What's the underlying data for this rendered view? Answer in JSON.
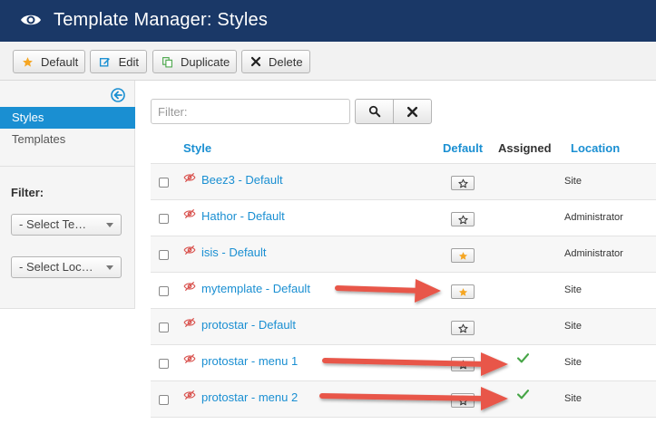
{
  "header": {
    "title": "Template Manager: Styles",
    "icon": "eye-icon"
  },
  "toolbar": {
    "buttons": [
      {
        "label": "Default",
        "icon": "star-icon"
      },
      {
        "label": "Edit",
        "icon": "edit-icon"
      },
      {
        "label": "Duplicate",
        "icon": "duplicate-icon"
      },
      {
        "label": "Delete",
        "icon": "close-icon"
      }
    ]
  },
  "sidebar": {
    "items": [
      {
        "label": "Styles",
        "active": true
      },
      {
        "label": "Templates",
        "active": false
      }
    ],
    "filter_label": "Filter:",
    "select_template": "- Select Te…",
    "select_location": "- Select Loc…"
  },
  "search": {
    "placeholder": "Filter:",
    "value": ""
  },
  "table": {
    "headers": {
      "style": "Style",
      "default": "Default",
      "assigned": "Assigned",
      "location": "Location"
    },
    "rows": [
      {
        "name": "Beez3 - Default",
        "default": false,
        "assigned": false,
        "location": "Site"
      },
      {
        "name": "Hathor - Default",
        "default": false,
        "assigned": false,
        "location": "Administrator"
      },
      {
        "name": "isis - Default",
        "default": true,
        "assigned": false,
        "location": "Administrator"
      },
      {
        "name": "mytemplate - Default",
        "default": true,
        "assigned": false,
        "location": "Site"
      },
      {
        "name": "protostar - Default",
        "default": false,
        "assigned": false,
        "location": "Site"
      },
      {
        "name": "protostar - menu 1",
        "default": false,
        "assigned": true,
        "location": "Site"
      },
      {
        "name": "protostar - menu 2",
        "default": false,
        "assigned": true,
        "location": "Site"
      }
    ]
  },
  "colors": {
    "header": "#1a3867",
    "link": "#1a8fd2",
    "star_default": "#f5a623",
    "check": "#46a546",
    "annotation_arrow": "#e8574a"
  }
}
